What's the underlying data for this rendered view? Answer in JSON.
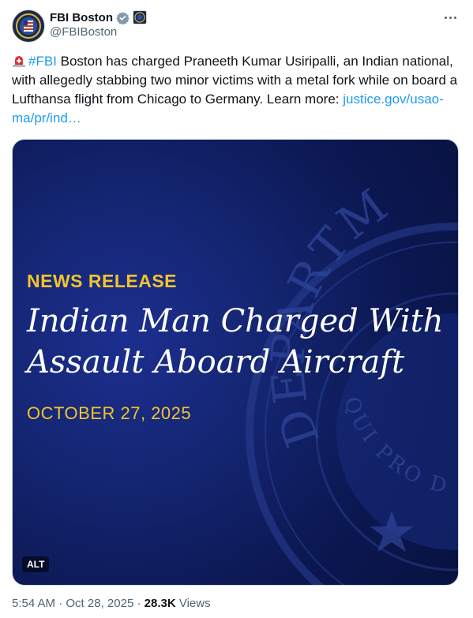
{
  "author": {
    "display_name": "FBI Boston",
    "handle": "@FBIBoston"
  },
  "tweet": {
    "hashtag": "#FBI",
    "body": " Boston has charged Praneeth Kumar Usiripalli, an Indian national, with allegedly stabbing two minor victims with a metal fork while on board a Lufthansa flight from Chicago to Germany. Learn more: ",
    "link": "justice.gov/usao-ma/pr/ind…"
  },
  "media": {
    "label": "NEWS RELEASE",
    "headline": "Indian Man Charged With Assault Aboard Aircraft",
    "date": "OCTOBER 27, 2025",
    "seal_text_top": "DEPARTMENT",
    "seal_text_bottom": "QUI PRO DOMINA",
    "alt_badge": "ALT"
  },
  "meta": {
    "time": "5:54 AM",
    "separator": "·",
    "date": "Oct 28, 2025",
    "views_count": "28.3K",
    "views_label": "Views"
  },
  "colors": {
    "link": "#1d9bf0",
    "accent_yellow": "#f2c42c",
    "card_bg": "#142571",
    "muted_text": "#536471"
  },
  "icons": {
    "avatar": "fbi-seal-icon",
    "verified": "verified-badge-icon",
    "affiliation": "affiliation-badge-icon",
    "more": "more-options-icon",
    "siren": "siren-emoji-icon"
  }
}
